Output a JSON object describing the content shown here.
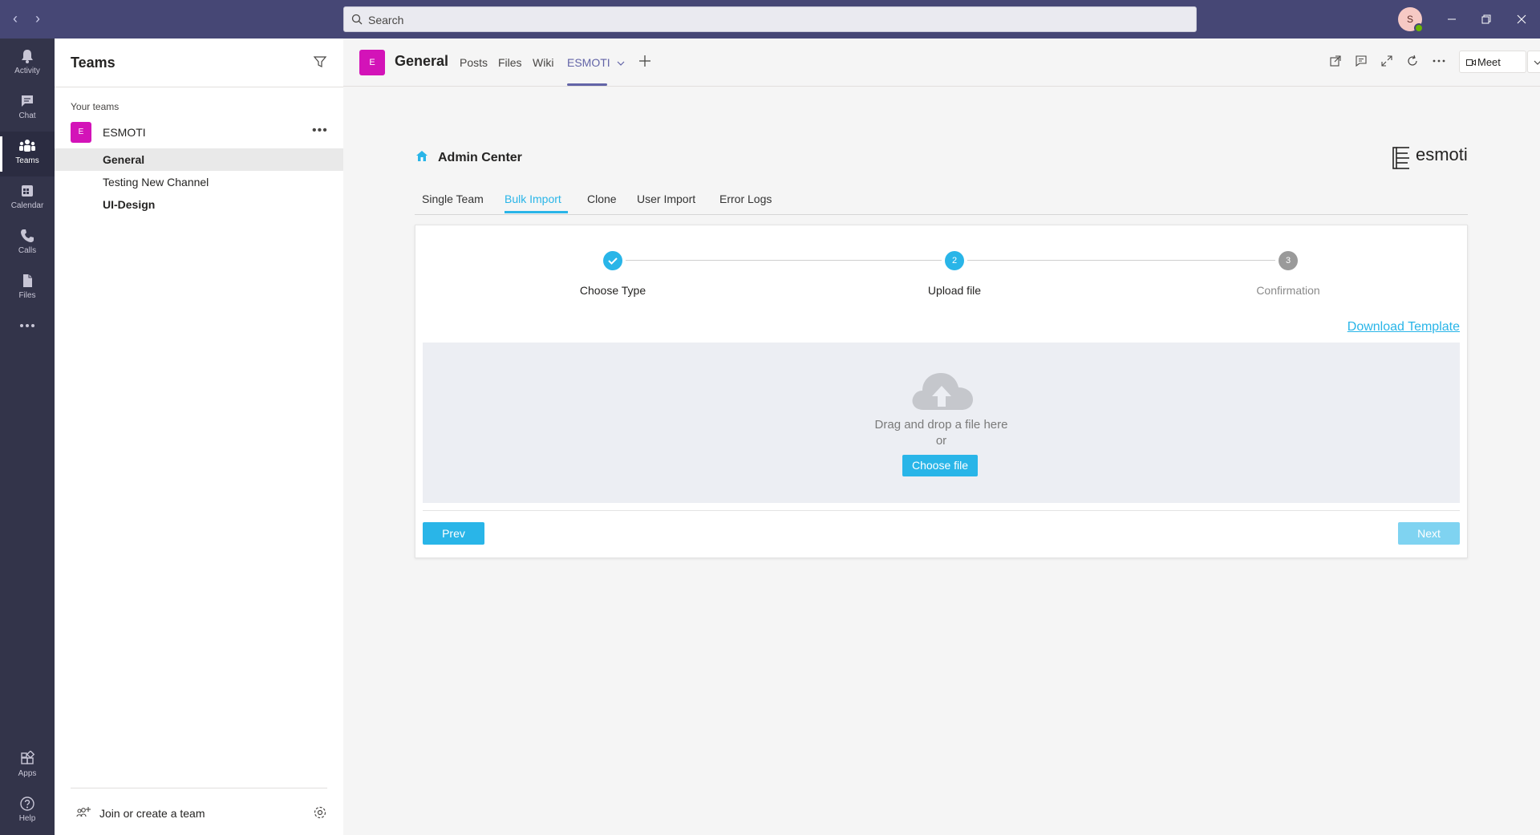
{
  "titlebar": {
    "search_placeholder": "Search",
    "avatar_initial": "S"
  },
  "rail": {
    "items": [
      {
        "label": "Activity",
        "icon": "bell-icon"
      },
      {
        "label": "Chat",
        "icon": "chat-icon"
      },
      {
        "label": "Teams",
        "icon": "teams-icon",
        "active": true
      },
      {
        "label": "Calendar",
        "icon": "calendar-icon"
      },
      {
        "label": "Calls",
        "icon": "phone-icon"
      },
      {
        "label": "Files",
        "icon": "file-icon"
      }
    ],
    "bottom": [
      {
        "label": "Apps",
        "icon": "apps-icon"
      },
      {
        "label": "Help",
        "icon": "help-icon"
      }
    ]
  },
  "teams_panel": {
    "title": "Teams",
    "section_label": "Your teams",
    "team": {
      "initial": "E",
      "name": "ESMOTI"
    },
    "channels": [
      {
        "name": "General",
        "selected": true,
        "bold": true
      },
      {
        "name": "Testing New Channel",
        "selected": false,
        "bold": false
      },
      {
        "name": "UI-Design",
        "selected": false,
        "bold": true
      }
    ],
    "join_label": "Join or create a team"
  },
  "channel_header": {
    "avatar_initial": "E",
    "title": "General",
    "tabs": [
      "Posts",
      "Files",
      "Wiki",
      "ESMOTI"
    ],
    "active_tab": "ESMOTI",
    "meet_label": "Meet"
  },
  "app": {
    "title": "Admin Center",
    "brand": "esmoti",
    "tabs": [
      "Single Team",
      "Bulk Import",
      "Clone",
      "User Import",
      "Error Logs"
    ],
    "active_tab": "Bulk Import",
    "steps": [
      {
        "number": "",
        "label": "Choose Type",
        "state": "done"
      },
      {
        "number": "2",
        "label": "Upload file",
        "state": "current"
      },
      {
        "number": "3",
        "label": "Confirmation",
        "state": "pending"
      }
    ],
    "download_template": "Download Template",
    "drop_text": "Drag and drop a file here",
    "drop_or": "or",
    "choose_file": "Choose file",
    "prev": "Prev",
    "next": "Next"
  },
  "colors": {
    "titlebar": "#464775",
    "rail": "#33344a",
    "accent_teams": "#6264a7",
    "accent_app": "#29b5e8",
    "team_avatar": "#d313b8"
  }
}
